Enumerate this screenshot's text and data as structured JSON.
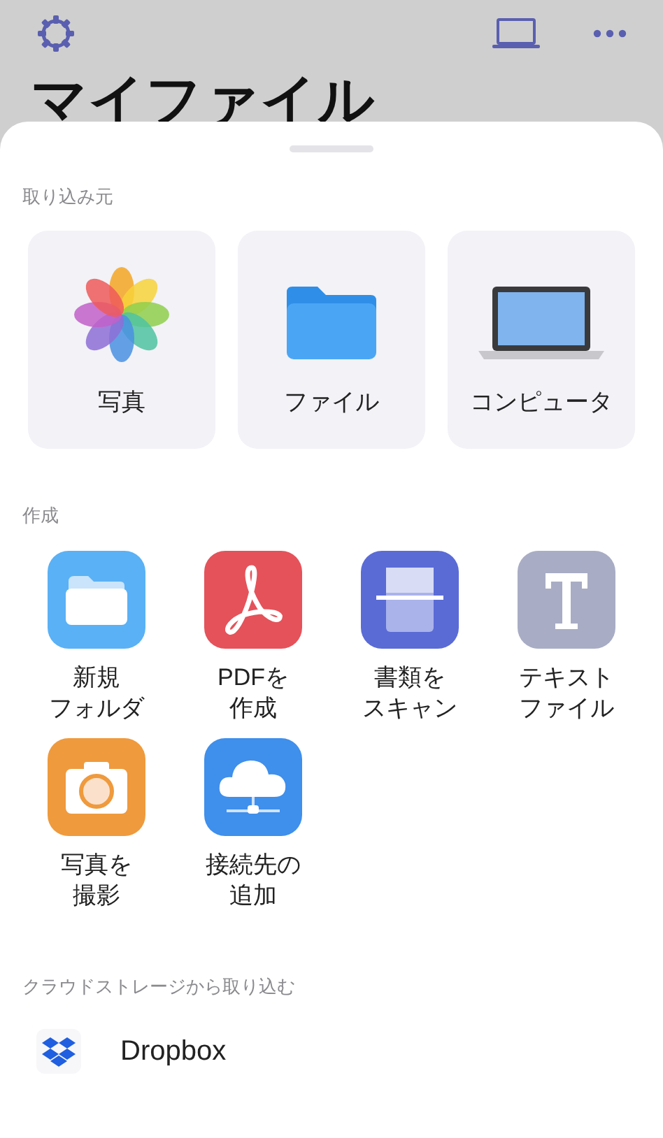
{
  "header": {
    "title": "マイファイル"
  },
  "sources": {
    "heading": "取り込み元",
    "items": [
      {
        "kind": "photos",
        "label": "写真"
      },
      {
        "kind": "files",
        "label": "ファイル"
      },
      {
        "kind": "computer",
        "label": "コンピュータ"
      }
    ]
  },
  "create": {
    "heading": "作成",
    "items": [
      {
        "kind": "folder",
        "label": [
          "新規",
          "フォルダ"
        ]
      },
      {
        "kind": "pdf",
        "label": [
          "PDFを",
          "作成"
        ]
      },
      {
        "kind": "scan",
        "label": [
          "書類を",
          "スキャン"
        ]
      },
      {
        "kind": "text",
        "label": [
          "テキスト",
          "ファイル"
        ]
      },
      {
        "kind": "camera",
        "label": [
          "写真を",
          "撮影"
        ]
      },
      {
        "kind": "server",
        "label": [
          "接続先の",
          "追加"
        ]
      }
    ]
  },
  "cloud": {
    "heading": "クラウドストレージから取り込む",
    "items": [
      {
        "kind": "dropbox",
        "label": "Dropbox"
      }
    ]
  }
}
